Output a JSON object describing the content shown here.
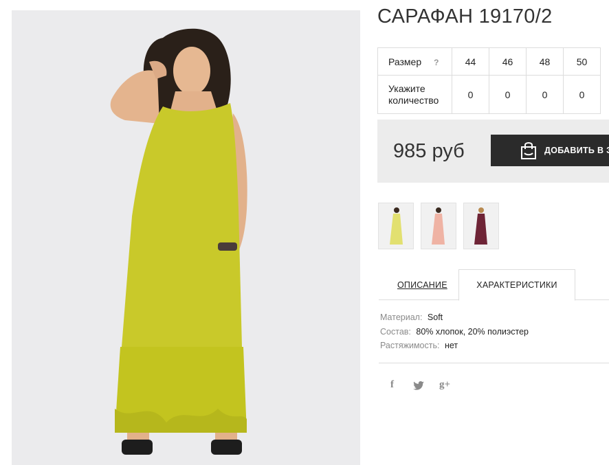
{
  "product": {
    "title": "САРАФАН 19170/2",
    "image_alt": "Model wearing long yellow-mustard sleeveless dress with ruffled hem"
  },
  "sizes": {
    "size_label": "Размер",
    "help_icon": "?",
    "qty_label": "Укажите количество",
    "columns": [
      {
        "size": "44",
        "qty": "0"
      },
      {
        "size": "46",
        "qty": "0"
      },
      {
        "size": "48",
        "qty": "0"
      },
      {
        "size": "50",
        "qty": "0"
      }
    ]
  },
  "purchase": {
    "price": "985 руб",
    "add_button": "ДОБАВИТЬ В З"
  },
  "variants": [
    {
      "color": "#e2e070",
      "name": "yellow"
    },
    {
      "color": "#efb3a4",
      "name": "peach"
    },
    {
      "color": "#6e2436",
      "name": "burgundy"
    }
  ],
  "tabs": {
    "description": "ОПИСАНИЕ",
    "characteristics": "ХАРАКТЕРИСТИКИ"
  },
  "specs": [
    {
      "key": "Материал:",
      "value": "Soft"
    },
    {
      "key": "Состав:",
      "value": "80% хлопок, 20% полиэстер"
    },
    {
      "key": "Растяжимость:",
      "value": "нет"
    }
  ],
  "social": {
    "facebook": "f",
    "twitter": "twitter-icon",
    "google": "g+"
  },
  "colors": {
    "dress": "#c9c92a",
    "button": "#2b2b2b",
    "price_bg": "#ececec"
  }
}
